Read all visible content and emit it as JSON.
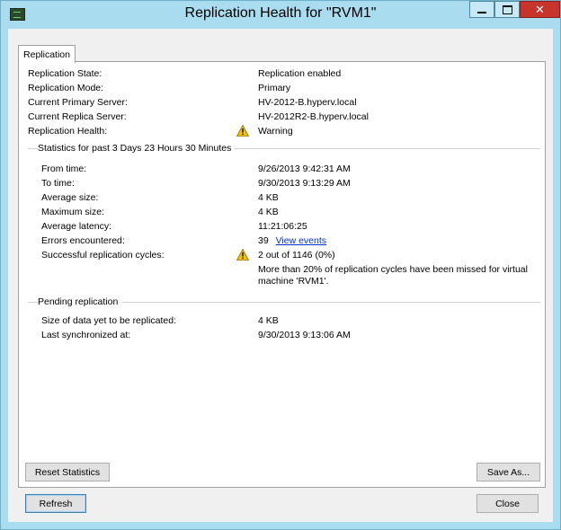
{
  "window": {
    "title": "Replication Health for \"RVM1\"",
    "close_glyph": "✕"
  },
  "tab": {
    "label": "Replication"
  },
  "summary": [
    {
      "label": "Replication State:",
      "value": "Replication enabled"
    },
    {
      "label": "Replication Mode:",
      "value": "Primary"
    },
    {
      "label": "Current Primary Server:",
      "value": "HV-2012-B.hyperv.local"
    },
    {
      "label": "Current Replica Server:",
      "value": "HV-2012R2-B.hyperv.local"
    },
    {
      "label": "Replication Health:",
      "value": "Warning",
      "icon": "warning-icon"
    }
  ],
  "statistics": {
    "header": "Statistics for past 3 Days 23 Hours 30 Minutes",
    "rows": [
      {
        "label": "From time:",
        "value": "9/26/2013 9:42:31 AM"
      },
      {
        "label": "To time:",
        "value": "9/30/2013 9:13:29 AM"
      },
      {
        "label": "Average size:",
        "value": "4 KB"
      },
      {
        "label": "Maximum size:",
        "value": "4 KB"
      },
      {
        "label": "Average latency:",
        "value": "11:21:06:25"
      },
      {
        "label": "Errors encountered:",
        "value": "39",
        "link": "View events"
      },
      {
        "label": "Successful replication cycles:",
        "value": "2 out of 1146 (0%)",
        "icon": "warning-icon"
      }
    ],
    "note_line1": "More than 20% of replication cycles have been missed for virtual",
    "note_line2": "machine 'RVM1'."
  },
  "pending": {
    "header": "Pending replication",
    "rows": [
      {
        "label": "Size of data yet to be replicated:",
        "value": "4 KB"
      },
      {
        "label": "Last synchronized at:",
        "value": "9/30/2013 9:13:06 AM"
      }
    ]
  },
  "buttons": {
    "reset": "Reset Statistics",
    "save_as": "Save As...",
    "refresh": "Refresh",
    "close": "Close"
  },
  "colors": {
    "warning": "#f2c200",
    "link": "#0033cc",
    "title_bar": "#a9dcef"
  }
}
